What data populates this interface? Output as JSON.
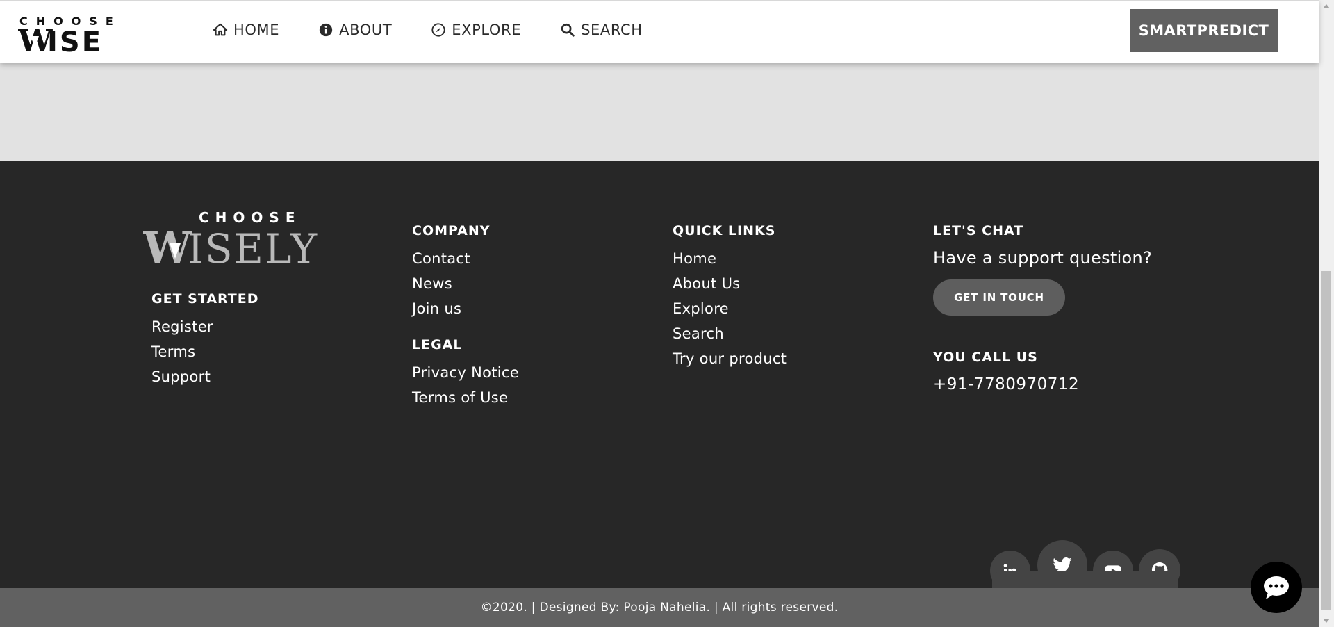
{
  "header": {
    "logo_alt": "CHOOSE WISE",
    "nav": [
      {
        "label": "HOME",
        "icon": "home-icon"
      },
      {
        "label": "ABOUT",
        "icon": "info-icon"
      },
      {
        "label": "EXPLORE",
        "icon": "compass-icon"
      },
      {
        "label": "SEARCH",
        "icon": "search-icon"
      }
    ],
    "cta_label": "SMARTPREDICT"
  },
  "footer": {
    "logo_alt": "CHOOSE WISELY",
    "get_started": {
      "heading": "GET STARTED",
      "links": [
        "Register",
        "Terms",
        "Support"
      ]
    },
    "company": {
      "heading": "COMPANY",
      "links": [
        "Contact",
        "News",
        "Join us"
      ]
    },
    "legal": {
      "heading": "LEGAL",
      "links": [
        "Privacy Notice",
        "Terms of Use"
      ]
    },
    "quick_links": {
      "heading": "QUICK LINKS",
      "links": [
        "Home",
        "About Us",
        "Explore",
        "Search",
        "Try our product"
      ]
    },
    "chat": {
      "heading": "LET'S CHAT",
      "question": "Have a support question?",
      "button_label": "GET IN TOUCH",
      "call_heading": "YOU CALL US",
      "phone": "+91-7780970712"
    },
    "social": [
      "linkedin-icon",
      "twitter-icon",
      "youtube-icon",
      "github-icon"
    ],
    "copyright": "©2020. | Designed By: Pooja Nahelia. | All rights reserved."
  },
  "colors": {
    "footer_bg": "#272727",
    "copyright_bg": "#616161",
    "button_bg": "#616161",
    "band_bg": "#e2e2e2"
  }
}
